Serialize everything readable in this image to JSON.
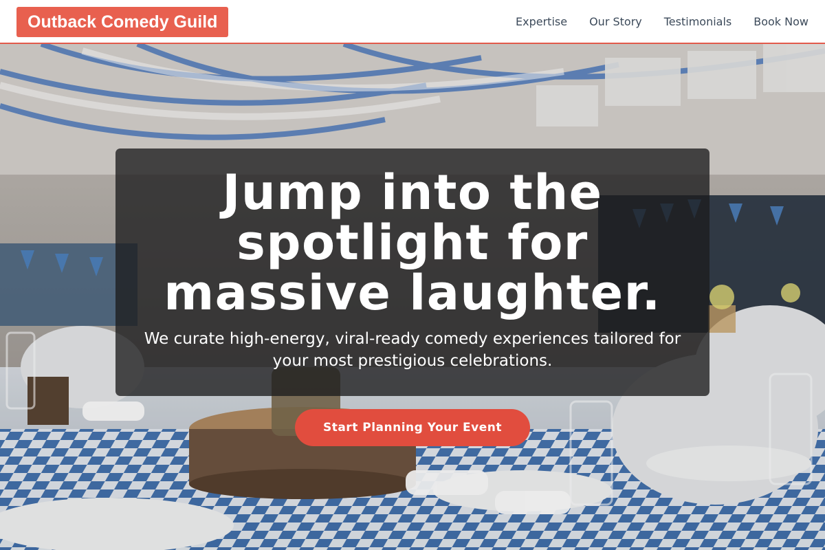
{
  "header": {
    "logo": "Outback Comedy Guild",
    "nav": [
      "Expertise",
      "Our Story",
      "Testimonials",
      "Book Now"
    ]
  },
  "hero": {
    "title": "Jump into the spotlight for massive laughter.",
    "subtitle": "We curate high-energy, viral-ready comedy experiences tailored for your most prestigious celebrations.",
    "cta": "Start Planning Your Event"
  },
  "colors": {
    "accent": "#e8604f",
    "cta": "#e14d3e",
    "nav_text": "#3c4a5a",
    "overlay": "#1c1c1e"
  }
}
